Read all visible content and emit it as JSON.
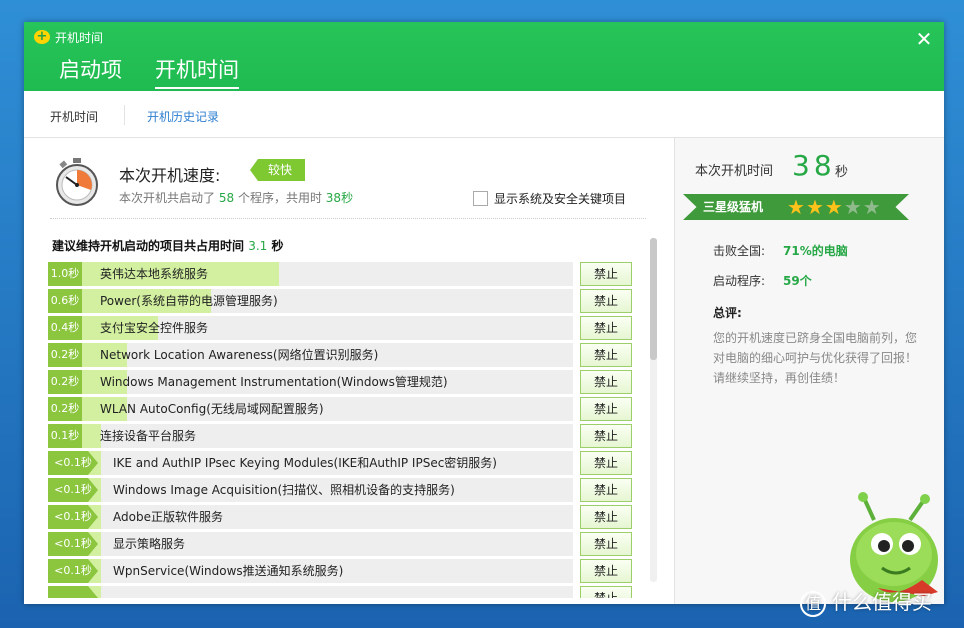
{
  "window": {
    "title": "开机时间",
    "logo": "360-logo",
    "close_label": "✕"
  },
  "main_tabs": [
    {
      "label": "启动项",
      "active": false
    },
    {
      "label": "开机时间",
      "active": true
    }
  ],
  "sub_tabs": [
    {
      "label": "开机时间",
      "active": true
    },
    {
      "label": "开机历史记录",
      "active": false
    }
  ],
  "speed": {
    "label": "本次开机速度:",
    "badge": "较快",
    "summary_prefix": "本次开机共启动了",
    "program_count": "58",
    "summary_mid": "个程序，共用时",
    "total_time": "38秒"
  },
  "show_system_items": {
    "label": "显示系统及安全关键项目",
    "checked": false
  },
  "list_header": {
    "prefix": "建议维持开机启动的项目共占用时间",
    "value": "3.1",
    "unit": "秒"
  },
  "forbid_label": "禁止",
  "items": [
    {
      "time": "1.0秒",
      "name": "英伟达本地系统服务",
      "fill_pct": 44
    },
    {
      "time": "0.6秒",
      "name": "Power(系统自带的电源管理服务)",
      "fill_pct": 31
    },
    {
      "time": "0.4秒",
      "name": "支付宝安全控件服务",
      "fill_pct": 21
    },
    {
      "time": "0.2秒",
      "name": "Network Location Awareness(网络位置识别服务)",
      "fill_pct": 15
    },
    {
      "time": "0.2秒",
      "name": "Windows Management Instrumentation(Windows管理规范)",
      "fill_pct": 15
    },
    {
      "time": "0.2秒",
      "name": "WLAN AutoConfig(无线局域网配置服务)",
      "fill_pct": 15
    },
    {
      "time": "0.1秒",
      "name": "连接设备平台服务",
      "fill_pct": 10
    },
    {
      "time": "<0.1秒",
      "name": "IKE and AuthIP IPsec Keying Modules(IKE和AuthIP IPSec密钥服务)",
      "fill_pct": 10
    },
    {
      "time": "<0.1秒",
      "name": "Windows Image Acquisition(扫描仪、照相机设备的支持服务)",
      "fill_pct": 10
    },
    {
      "time": "<0.1秒",
      "name": "Adobe正版软件服务",
      "fill_pct": 10
    },
    {
      "time": "<0.1秒",
      "name": "显示策略服务",
      "fill_pct": 10
    },
    {
      "time": "<0.1秒",
      "name": "WpnService(Windows推送通知系统服务)",
      "fill_pct": 10
    },
    {
      "time": "",
      "name": "",
      "fill_pct": 10
    }
  ],
  "right": {
    "time_label": "本次开机时间",
    "time_value": "38",
    "time_unit": "秒",
    "rank": "三星级猛机",
    "stars_on": 3,
    "stars_total": 5,
    "beat_label": "击败全国:",
    "beat_value": "71%的电脑",
    "programs_label": "启动程序:",
    "programs_value": "59个",
    "comment_title": "总评:",
    "comment_text": "您的开机速度已跻身全国电脑前列，您对电脑的细心呵护与优化获得了回报！请继续坚持，再创佳绩！"
  },
  "watermark": {
    "logo": "值",
    "text": "什么值得买"
  },
  "colors": {
    "brand_green": "#1fbb51",
    "accent_green": "#27a846",
    "bar_fill": "#d2f0a0",
    "tag_green": "#8cc63f",
    "link_blue": "#2f7fd0"
  }
}
